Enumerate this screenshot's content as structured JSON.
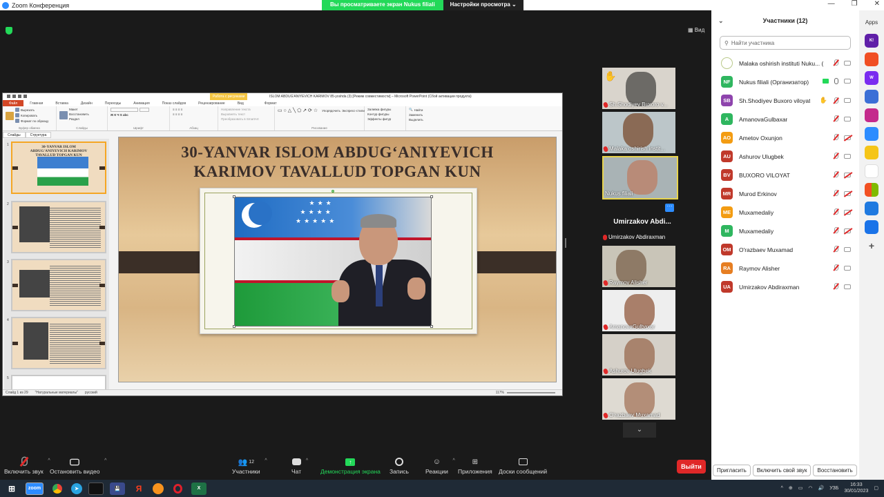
{
  "window": {
    "title": "Zoom Конференция"
  },
  "banner": {
    "viewing": "Вы просматриваете экран Nukus filiali",
    "settings": "Настройки просмотра"
  },
  "stage": {
    "view": "Вид"
  },
  "ppt": {
    "title": "ISLOM ABDUG'ANIYEVICH KARIMOV 85-yoshda (3) [Режим совместимости] – Microsoft PowerPoint (Сбой активации продукта)",
    "context_tab": "Работа с рисунками",
    "tabs": [
      "Файл",
      "Главная",
      "Вставка",
      "Дизайн",
      "Переходы",
      "Анимация",
      "Показ слайдов",
      "Рецензирование",
      "Вид",
      "Формат"
    ],
    "ribbon": {
      "paste": "Вставить",
      "cut": "Вырезать",
      "copy": "Копировать",
      "format_painter": "Формат по образцу",
      "clipboard": "Буфер обмена",
      "layout": "Макет",
      "reset": "Восстановить",
      "new_slide": "Создать слайд",
      "section": "Раздел",
      "slides": "Слайды",
      "font": "Шрифт",
      "paragraph": "Абзац",
      "text_dir": "Направление текста",
      "align_text": "Выровнять текст",
      "smartart": "Преобразовать в SmartArt",
      "arrange": "Упорядочить",
      "quick_styles": "Экспресс-стили",
      "drawing": "Рисование",
      "shape_fill": "Заливка фигуры",
      "shape_outline": "Контур фигуры",
      "shape_effects": "Эффекты фигур",
      "find": "Найти",
      "replace": "Заменить",
      "select": "Выделить",
      "editing": "Редактирование"
    },
    "side_tabs": [
      "Слайды",
      "Структура"
    ],
    "thumb_numbers": [
      "1",
      "2",
      "3",
      "4",
      "5"
    ],
    "thumb_title": "30-YANVAR ISLOM ABDUG'ANIYEVICH KARIMOV TAVALLUD TOPGAN KUN",
    "slide_title_l1": "30-YANVAR ISLOM ABDUG‘ANIYEVICH",
    "slide_title_l2": "KARIMOV TAVALLUD TOPGAN KUN",
    "status": {
      "slide": "Слайд 1 из 29",
      "theme": "\"Натуральные материалы\"",
      "lang": "русский",
      "zoom": "117%"
    }
  },
  "tiles": [
    {
      "name": "Sh.Shodiyev Buxoro v..."
    },
    {
      "name": "Malaka oshirish instit..."
    },
    {
      "name": "Nukus filiali"
    },
    {
      "name": "Umirzakov Abdiraxman"
    },
    {
      "name": "Raymov Alisher"
    },
    {
      "name": "AmanovaGulbaxar"
    },
    {
      "name": "Ashurov Ulugbek"
    },
    {
      "name": "O'razbaev Muxamad"
    }
  ],
  "namecard": "Umirzakov Abdi...",
  "panel": {
    "title": "Участники (12)",
    "search_placeholder": "Найти участника",
    "participants": [
      {
        "initials": "",
        "name": "Malaka oshirish instituti Nuku... (Я)",
        "color": "#ffffff"
      },
      {
        "initials": "NF",
        "name": "Nukus filiali (Организатор)",
        "color": "#2fb65f"
      },
      {
        "initials": "SB",
        "name": "Sh.Shodiyev Buxoro viloyat",
        "color": "#8e44ad"
      },
      {
        "initials": "A",
        "name": "AmanovaGulbaxar",
        "color": "#2fb65f"
      },
      {
        "initials": "AO",
        "name": "Ametov Oxunjon",
        "color": "#f39c12"
      },
      {
        "initials": "AU",
        "name": "Ashurov Ulugbek",
        "color": "#c0392b"
      },
      {
        "initials": "BV",
        "name": "BUXORO VILOYAT",
        "color": "#c0392b"
      },
      {
        "initials": "MR",
        "name": "Murod Erkinov",
        "color": "#c0392b"
      },
      {
        "initials": "ME",
        "name": "Muxamedaliy",
        "color": "#f39c12"
      },
      {
        "initials": "M",
        "name": "Muxamedaliy",
        "color": "#2fb65f"
      },
      {
        "initials": "OM",
        "name": "O'razbaev Muxamad",
        "color": "#c0392b"
      },
      {
        "initials": "RA",
        "name": "Raymov Alisher",
        "color": "#e67e22"
      },
      {
        "initials": "UA",
        "name": "Umirzakov Abdiraxman",
        "color": "#c0392b"
      }
    ],
    "footer": [
      "Пригласить",
      "Включить свой звук",
      "Восстановить"
    ]
  },
  "apps_label": "Apps",
  "toolbar": {
    "unmute": "Включить звук",
    "video": "Остановить видео",
    "participants_count": "12",
    "participants": "Участники",
    "chat": "Чат",
    "share": "Демонстрация экрана",
    "record": "Запись",
    "reactions": "Реакции",
    "apps": "Приложения",
    "whiteboards": "Доски сообщений",
    "leave": "Выйти"
  },
  "taskbar": {
    "lang": "УЗБ",
    "time": "16:33",
    "date": "30/01/2023"
  }
}
